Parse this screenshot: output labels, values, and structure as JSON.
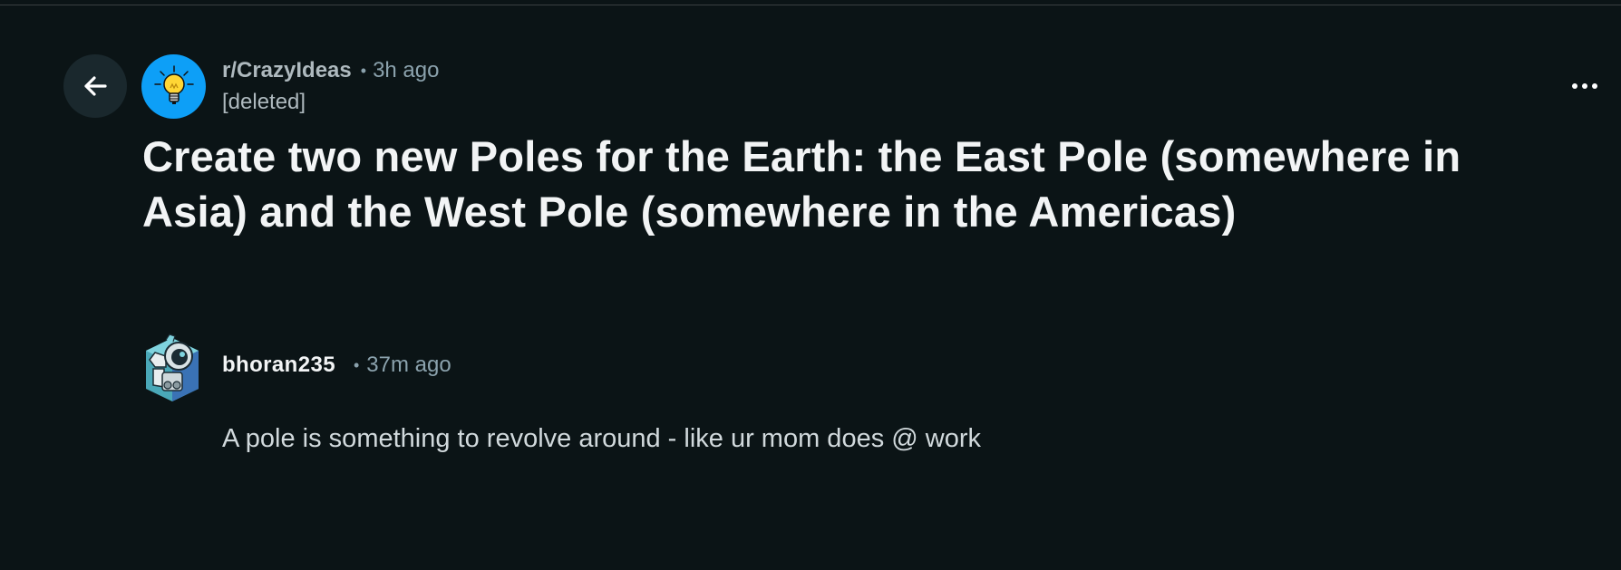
{
  "post": {
    "subreddit": "r/CrazyIdeas",
    "separator": "•",
    "time_ago": "3h ago",
    "author": "[deleted]",
    "title": "Create two new Poles for the Earth: the East Pole (somewhere in Asia) and the West Pole (somewhere in the Americas)"
  },
  "comment": {
    "author": "bhoran235",
    "separator": "•",
    "time_ago": "37m ago",
    "body": "A pole is something to revolve around - like ur mom does @ work"
  },
  "icons": {
    "back": "arrow-left-icon",
    "subreddit_avatar": "lightbulb-icon",
    "more": "more-horizontal-icon",
    "comment_avatar": "robot-avatar-icon"
  },
  "colors": {
    "background": "#0b1416",
    "title_text": "#f2f4f5",
    "muted_text": "#8ba2ad",
    "subreddit_avatar_bg": "#0d9ff7",
    "back_button_bg": "#1a282d"
  }
}
